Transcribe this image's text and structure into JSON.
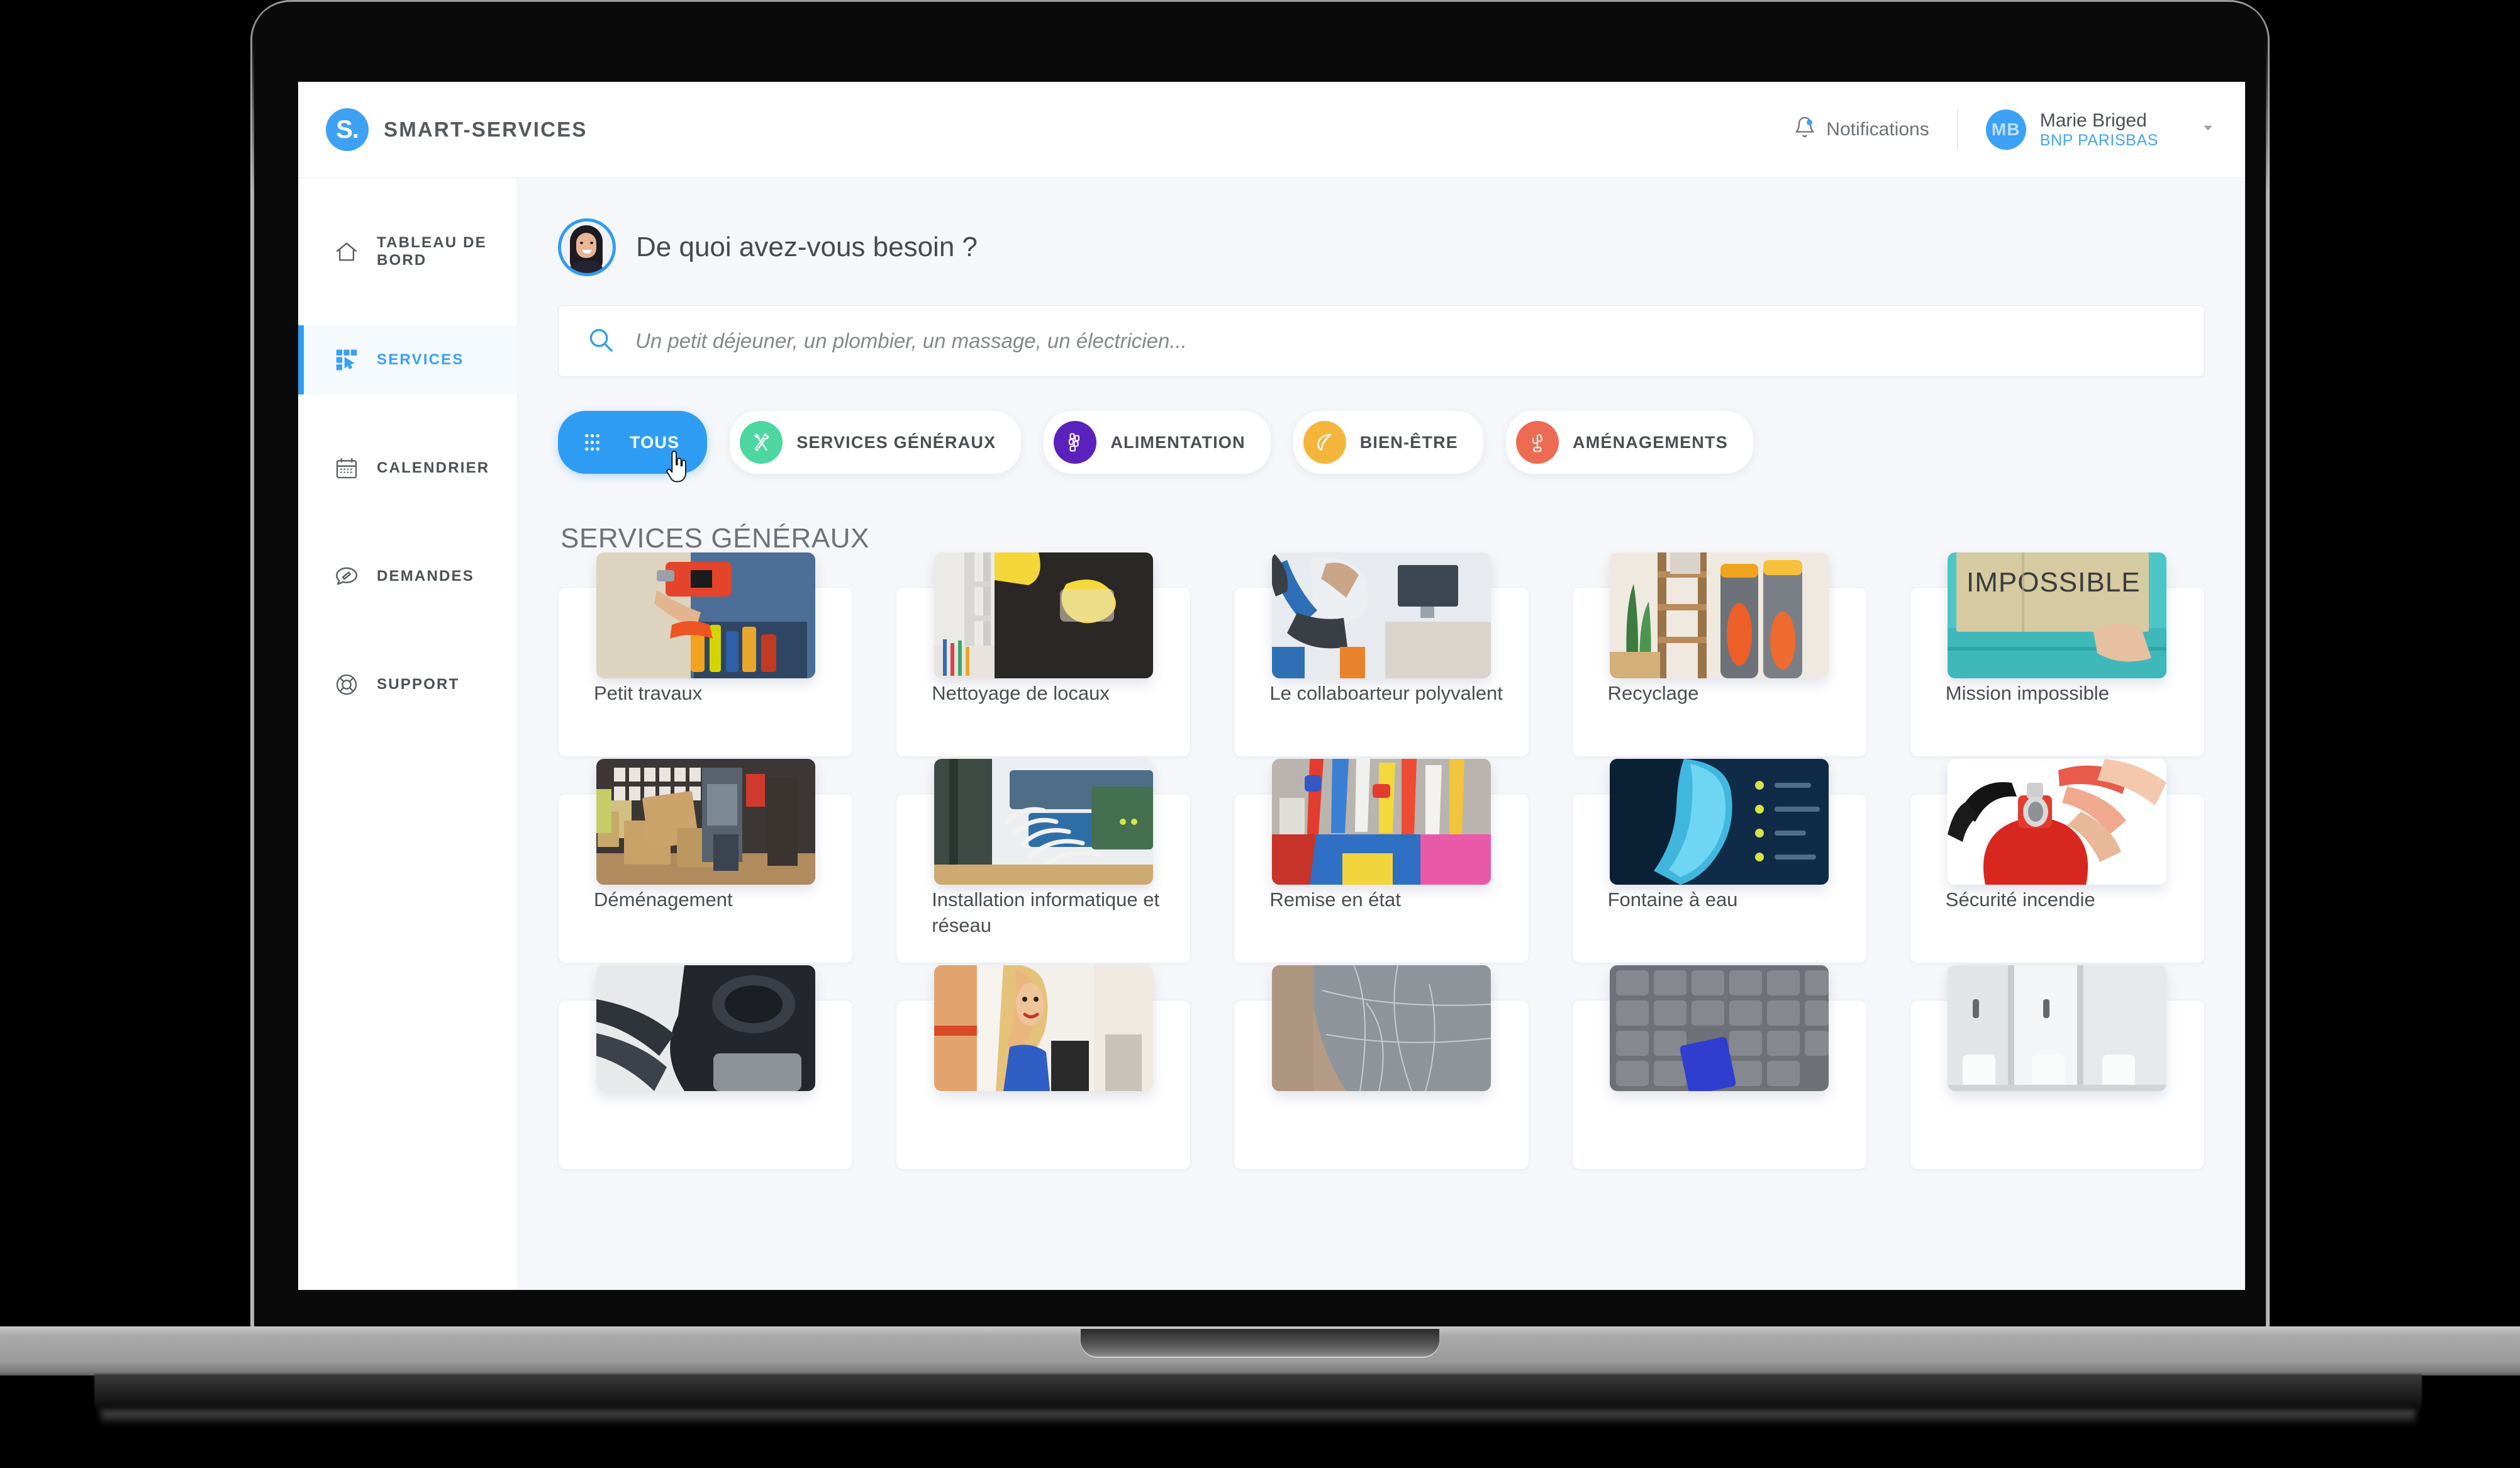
{
  "brand": {
    "logo_letter": "S.",
    "name": "SMART-SERVICES"
  },
  "header": {
    "notifications_label": "Notifications",
    "notifications_icon": "bell-icon",
    "user": {
      "initials": "MB",
      "name": "Marie Briged",
      "organization": "BNP PARISBAS"
    },
    "caret_icon": "chevron-down-icon"
  },
  "sidebar": {
    "items": [
      {
        "label": "TABLEAU DE BORD",
        "icon": "home-icon",
        "active": false
      },
      {
        "label": "SERVICES",
        "icon": "grid-cursor-icon",
        "active": true
      },
      {
        "label": "CALENDRIER",
        "icon": "calendar-icon",
        "active": false
      },
      {
        "label": "DEMANDES",
        "icon": "speech-bubble-pen-icon",
        "active": false
      },
      {
        "label": "SUPPORT",
        "icon": "lifebuoy-icon",
        "active": false
      }
    ]
  },
  "main": {
    "greeting": "De quoi avez-vous besoin ?",
    "greeting_avatar": "user-photo-avatar",
    "search": {
      "placeholder": "Un petit déjeuner, un plombier, un massage, un électricien...",
      "value": "",
      "icon": "search-icon"
    },
    "categories": [
      {
        "label": "TOUS",
        "icon": "dots-grid-icon",
        "color": "#2f9cf4",
        "active": true
      },
      {
        "label": "SERVICES GÉNÉRAUX",
        "icon": "tools-icon",
        "color": "#4cd7a0",
        "active": false
      },
      {
        "label": "ALIMENTATION",
        "icon": "food-stack-icon",
        "color": "#5b21bd",
        "active": false
      },
      {
        "label": "BIEN-ÊTRE",
        "icon": "leaf-icon",
        "color": "#f5b53c",
        "active": false
      },
      {
        "label": "AMÉNAGEMENTS",
        "icon": "cactus-icon",
        "color": "#ed6a53",
        "active": false
      }
    ],
    "section_title": "SERVICES GÉNÉRAUX",
    "cards": [
      {
        "title": "Petit travaux",
        "image": "handyman-drill-toolbelt"
      },
      {
        "title": "Nettoyage de locaux",
        "image": "yellow-glove-cleaning-desk"
      },
      {
        "title": "Le collaboarteur polyvalent",
        "image": "worker-vacuum-office"
      },
      {
        "title": "Recyclage",
        "image": "recycling-bins-shelf-plant"
      },
      {
        "title": "Mission impossible",
        "image": "cardboard-sign-impossible"
      },
      {
        "title": "Déménagement",
        "image": "office-moving-boxes"
      },
      {
        "title": "Installation informatique et réseau",
        "image": "network-cables-switch"
      },
      {
        "title": "Remise en état",
        "image": "cleaning-supplies-bucket"
      },
      {
        "title": "Fontaine à eau",
        "image": "water-bottle-blue"
      },
      {
        "title": "Sécurité incendie",
        "image": "fire-extinguisher-hand"
      }
    ],
    "cards_partial_row": [
      {
        "title": "",
        "image": "car-dashboard-dark"
      },
      {
        "title": "",
        "image": "woman-blonde-portrait"
      },
      {
        "title": "",
        "image": "cracked-grey-surface"
      },
      {
        "title": "",
        "image": "keyboard-blue-key"
      },
      {
        "title": "",
        "image": "white-bathroom-stalls"
      }
    ]
  },
  "colors": {
    "accent": "#2f9cf4",
    "brand_blue": "#3da1f5",
    "content_bg": "#f5f7fa",
    "text": "#4a4e53"
  },
  "cursor": {
    "type": "pointing-hand-cursor",
    "over": "TOUS"
  }
}
